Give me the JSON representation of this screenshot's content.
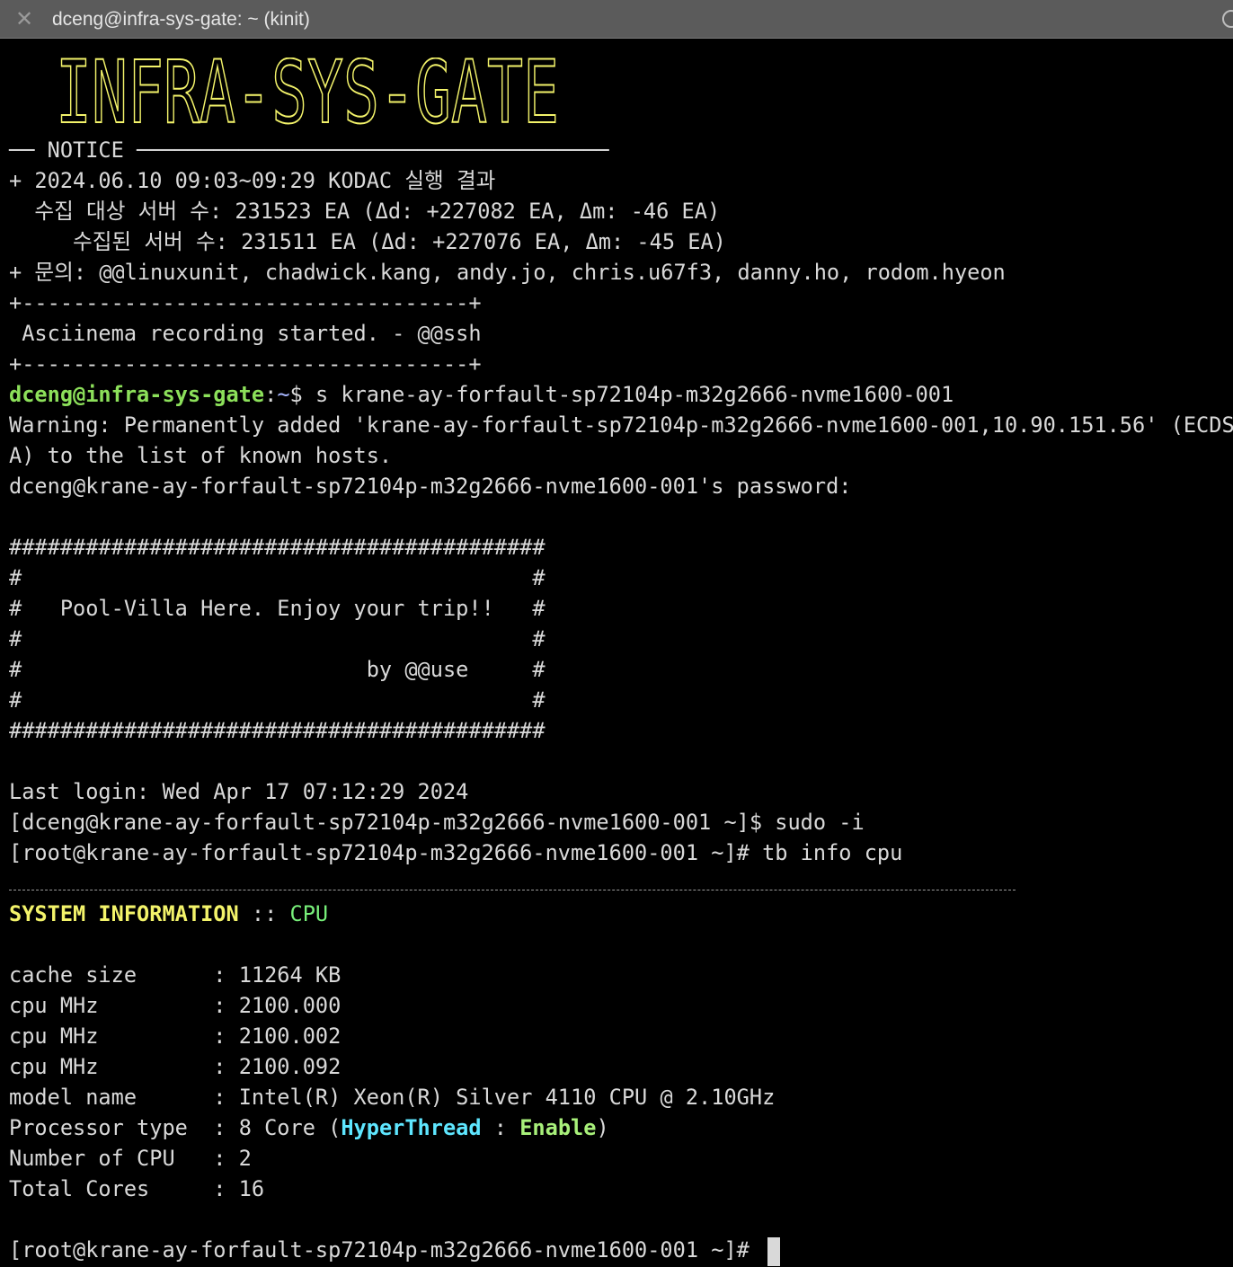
{
  "window": {
    "title": "dceng@infra-sys-gate: ~ (kinit)",
    "close_icon": "close-icon",
    "colors": {
      "titlebar": "#5b5b5b",
      "background": "#000000",
      "banner": "#f3f36a",
      "prompt_user": "#8ce05a",
      "prompt_path": "#a7b6ff"
    }
  },
  "banner": {
    "text": "INFRA-SYS-GATE"
  },
  "notice": {
    "header": "── NOTICE ─────────────────────────────────────",
    "line1": "+ 2024.06.10 09:03~09:29 KODAC 실행 결과",
    "line2": "  수집 대상 서버 수: 231523 EA (Δd: +227082 EA, Δm: -46 EA)",
    "line3": "     수집된 서버 수: 231511 EA (Δd: +227076 EA, Δm: -45 EA)",
    "line4": "+ 문의: @@linuxunit, chadwick.kang, andy.jo, chris.u67f3, danny.ho, rodom.hyeon"
  },
  "asciinema": {
    "border_top": "+-----------------------------------+",
    "message": " Asciinema recording started. - @@ssh",
    "border_bottom": "+-----------------------------------+"
  },
  "ssh": {
    "prompt_user": "dceng@infra-sys-gate",
    "prompt_sep": ":",
    "prompt_path": "~",
    "prompt_dollar": "$ ",
    "command": "s krane-ay-forfault-sp72104p-m32g2666-nvme1600-001",
    "warning1": "Warning: Permanently added 'krane-ay-forfault-sp72104p-m32g2666-nvme1600-001,10.90.151.56' (ECDS",
    "warning2": "A) to the list of known hosts.",
    "password": "dceng@krane-ay-forfault-sp72104p-m32g2666-nvme1600-001's password:"
  },
  "motd": {
    "l1": "##########################################",
    "l2": "#                                        #",
    "l3": "#   Pool-Villa Here. Enjoy your trip!!   #",
    "l4": "#                                        #",
    "l5": "#                           by @@use     #",
    "l6": "#                                        #",
    "l7": "##########################################"
  },
  "session": {
    "last_login": "Last login: Wed Apr 17 07:12:29 2024",
    "sudo_line": "[dceng@krane-ay-forfault-sp72104p-m32g2666-nvme1600-001 ~]$ sudo -i",
    "tb_line": "[root@krane-ay-forfault-sp72104p-m32g2666-nvme1600-001 ~]# tb info cpu"
  },
  "sysinfo": {
    "title": "SYSTEM INFORMATION",
    "sep": " :: ",
    "section": "CPU",
    "rows": [
      {
        "key": "cache size      ",
        "value": ": 11264 KB"
      },
      {
        "key": "cpu MHz         ",
        "value": ": 2100.000"
      },
      {
        "key": "cpu MHz         ",
        "value": ": 2100.002"
      },
      {
        "key": "cpu MHz         ",
        "value": ": 2100.092"
      },
      {
        "key": "model name      ",
        "value": ": Intel(R) Xeon(R) Silver 4110 CPU @ 2.10GHz"
      }
    ],
    "proc_key": "Processor type  ",
    "proc_pre": ": 8 Core (",
    "proc_ht": "HyperThread",
    "proc_mid": " : ",
    "proc_enable": "Enable",
    "proc_post": ")",
    "num_cpu": "Number of CPU   : 2",
    "total_cores": "Total Cores     : 16"
  },
  "final_prompt": "[root@krane-ay-forfault-sp72104p-m32g2666-nvme1600-001 ~]# "
}
